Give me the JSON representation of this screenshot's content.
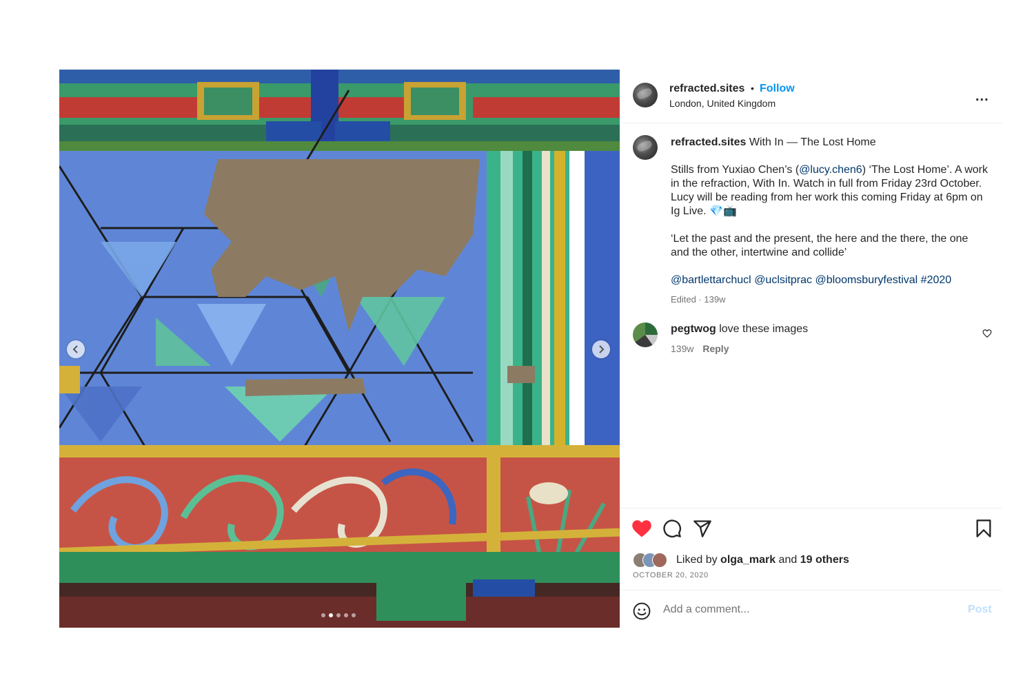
{
  "post": {
    "media": {
      "image_description_icon": "ornate-painted-beam-photo",
      "prev_icon": "chevron-left-icon",
      "next_icon": "chevron-right-icon",
      "slide_count": 5,
      "active_slide": 2
    },
    "header": {
      "username": "refracted.sites",
      "separator": "•",
      "follow_label": "Follow",
      "location": "London, United Kingdom",
      "more_icon": "more-horizontal-icon",
      "more_label": "..."
    },
    "caption": {
      "username": "refracted.sites",
      "title": "With In — The Lost Home",
      "p1_before": "Stills from Yuxiao Chen’s (",
      "p1_mention": "@lucy.chen6",
      "p1_after": ") ‘The Lost Home’. A work in the refraction, With In. Watch in full from Friday 23rd October. Lucy will be reading from her work this coming Friday at 6pm on Ig Live. 💎📺",
      "quote": "‘Let the past and the present, the here and the there, the one and the other, intertwine and collide’",
      "tags": [
        "@bartlettarchucl",
        "@uclsitprac",
        "@bloomsburyfestival",
        "#2020"
      ],
      "meta": "Edited · 139w"
    },
    "comment": {
      "username": "pegtwog",
      "text": "love these images",
      "age": "139w",
      "reply_label": "Reply"
    },
    "actions": {
      "like_icon": "heart-filled-icon",
      "comment_icon": "comment-bubble-icon",
      "share_icon": "send-icon",
      "save_icon": "bookmark-icon",
      "like_color": "#ff3040",
      "liked_prefix": "Liked by",
      "liked_user": "olga_mark",
      "liked_and": "and",
      "liked_others": "19 others",
      "date": "OCTOBER 20, 2020",
      "comment_placeholder": "Add a comment...",
      "post_label": "Post",
      "post_color": "#c0dffd",
      "emoji_icon": "smiley-icon"
    },
    "colors": {
      "follow": "#0095f6",
      "link": "#00376b",
      "muted": "#737373"
    }
  }
}
